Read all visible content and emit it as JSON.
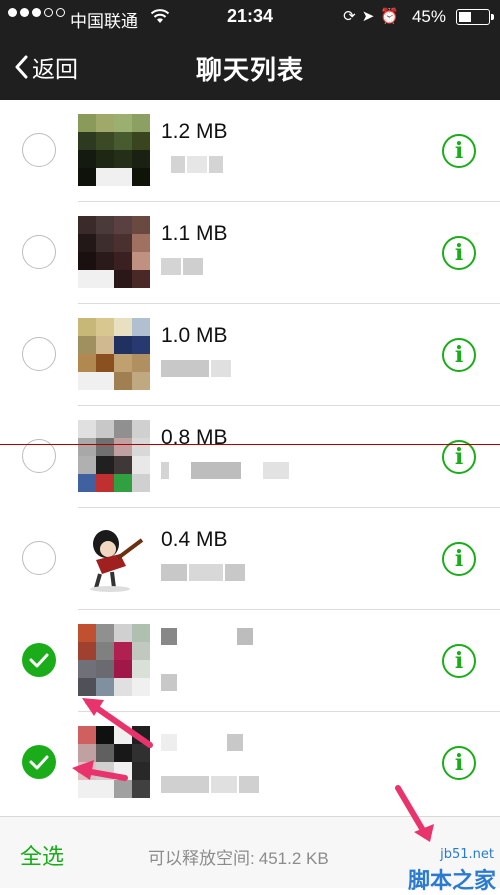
{
  "status_bar": {
    "carrier": "中国联通",
    "time": "21:34",
    "battery_percent": "45%",
    "battery_level": 0.45,
    "signal_bars_filled": 3,
    "signal_bars_total": 5
  },
  "nav": {
    "back_label": "返回",
    "title": "聊天列表"
  },
  "chats": [
    {
      "size": "1.2 MB",
      "name_fragment": "",
      "checked": false
    },
    {
      "size": "1.1 MB",
      "name_fragment": "",
      "checked": false
    },
    {
      "size": "1.0 MB",
      "name_fragment": "",
      "checked": false
    },
    {
      "size": "0.8 MB",
      "name_fragment": "",
      "checked": false
    },
    {
      "size": "0.4 MB",
      "name_fragment": "",
      "checked": false
    },
    {
      "size": "",
      "name_fragment": "",
      "checked": true
    },
    {
      "size": "",
      "name_fragment": "",
      "checked": true
    }
  ],
  "info_glyph": "i",
  "bottom": {
    "select_all": "全选",
    "freeable_label": "可以释放空间:",
    "freeable_value": "451.2 KB"
  },
  "watermark": {
    "url": "jb51.net",
    "name": "脚本之家"
  },
  "colors": {
    "accent": "#1aad19",
    "bar": "#1f1f1f",
    "annotation_arrow": "#e8336d"
  }
}
